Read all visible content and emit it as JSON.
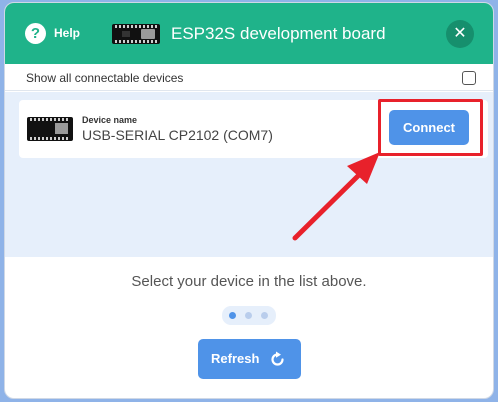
{
  "header": {
    "help_icon_glyph": "?",
    "help_label": "Help",
    "board_icon": "esp32-board-icon",
    "title": "ESP32S development board",
    "close_glyph": "✕"
  },
  "options": {
    "show_all_label": "Show all connectable devices",
    "show_all_checked": false
  },
  "device_list": [
    {
      "icon": "esp32-board-icon",
      "caption": "Device name",
      "name": "USB-SERIAL CP2102 (COM7)",
      "connect_label": "Connect"
    }
  ],
  "hint": "Select your device in the list above.",
  "pager": {
    "total": 3,
    "active": 1
  },
  "refresh": {
    "label": "Refresh",
    "icon": "refresh-icon"
  },
  "colors": {
    "header_bg": "#1fb38a",
    "accent_blue": "#4f93e8",
    "list_bg": "#e6effb",
    "annotation_red": "#e8212b"
  }
}
